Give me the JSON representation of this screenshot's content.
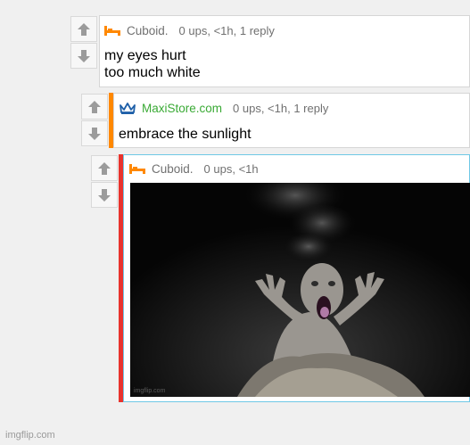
{
  "comments": [
    {
      "username": "Cuboid.",
      "user_icon": "orange-bed-icon",
      "stats": "0 ups, <1h, 1 reply",
      "lines": [
        "my eyes hurt",
        "too much white"
      ]
    },
    {
      "username": "MaxiStore.com",
      "user_icon": "blue-crown-icon",
      "stats": "0 ups, <1h, 1 reply",
      "lines": [
        "embrace the sunlight"
      ]
    },
    {
      "username": "Cuboid.",
      "user_icon": "orange-bed-icon",
      "stats": "0 ups, <1h",
      "image_watermark": "imgflip.com"
    }
  ],
  "footer": "imgflip.com",
  "colors": {
    "accent_orange": "#ff8800",
    "accent_red": "#e8332d",
    "highlight_border": "#6fc8e6",
    "username_green": "#3aaa35",
    "page_bg": "#f0f0f0"
  }
}
